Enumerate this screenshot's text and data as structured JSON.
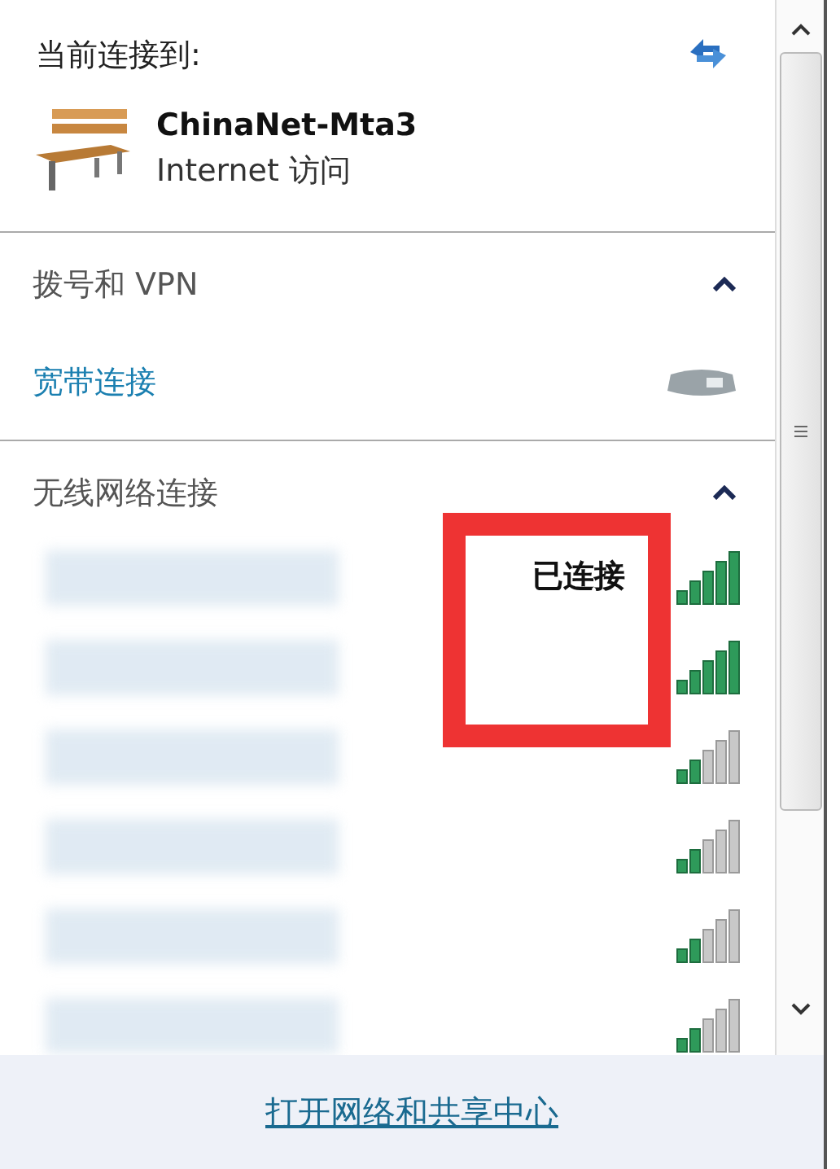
{
  "current": {
    "heading": "当前连接到:",
    "network": "ChinaNet-Mta3",
    "access": "Internet 访问"
  },
  "sections": [
    {
      "title": "拨号和 VPN",
      "expanded": true,
      "kind": "dialup",
      "items": [
        {
          "name": "宽带连接"
        }
      ]
    },
    {
      "title": "无线网络连接",
      "expanded": true,
      "kind": "wireless",
      "networks": [
        {
          "status": "已连接",
          "kind": "strong",
          "highlight": true
        },
        {
          "kind": "strong",
          "highlight": false
        },
        {
          "kind": "weak",
          "highlight": false
        },
        {
          "kind": "weak",
          "highlight": false
        },
        {
          "kind": "weak",
          "highlight": false
        },
        {
          "kind": "weak",
          "highlight": false
        }
      ]
    }
  ],
  "footer": {
    "link": "打开网络和共享中心"
  }
}
